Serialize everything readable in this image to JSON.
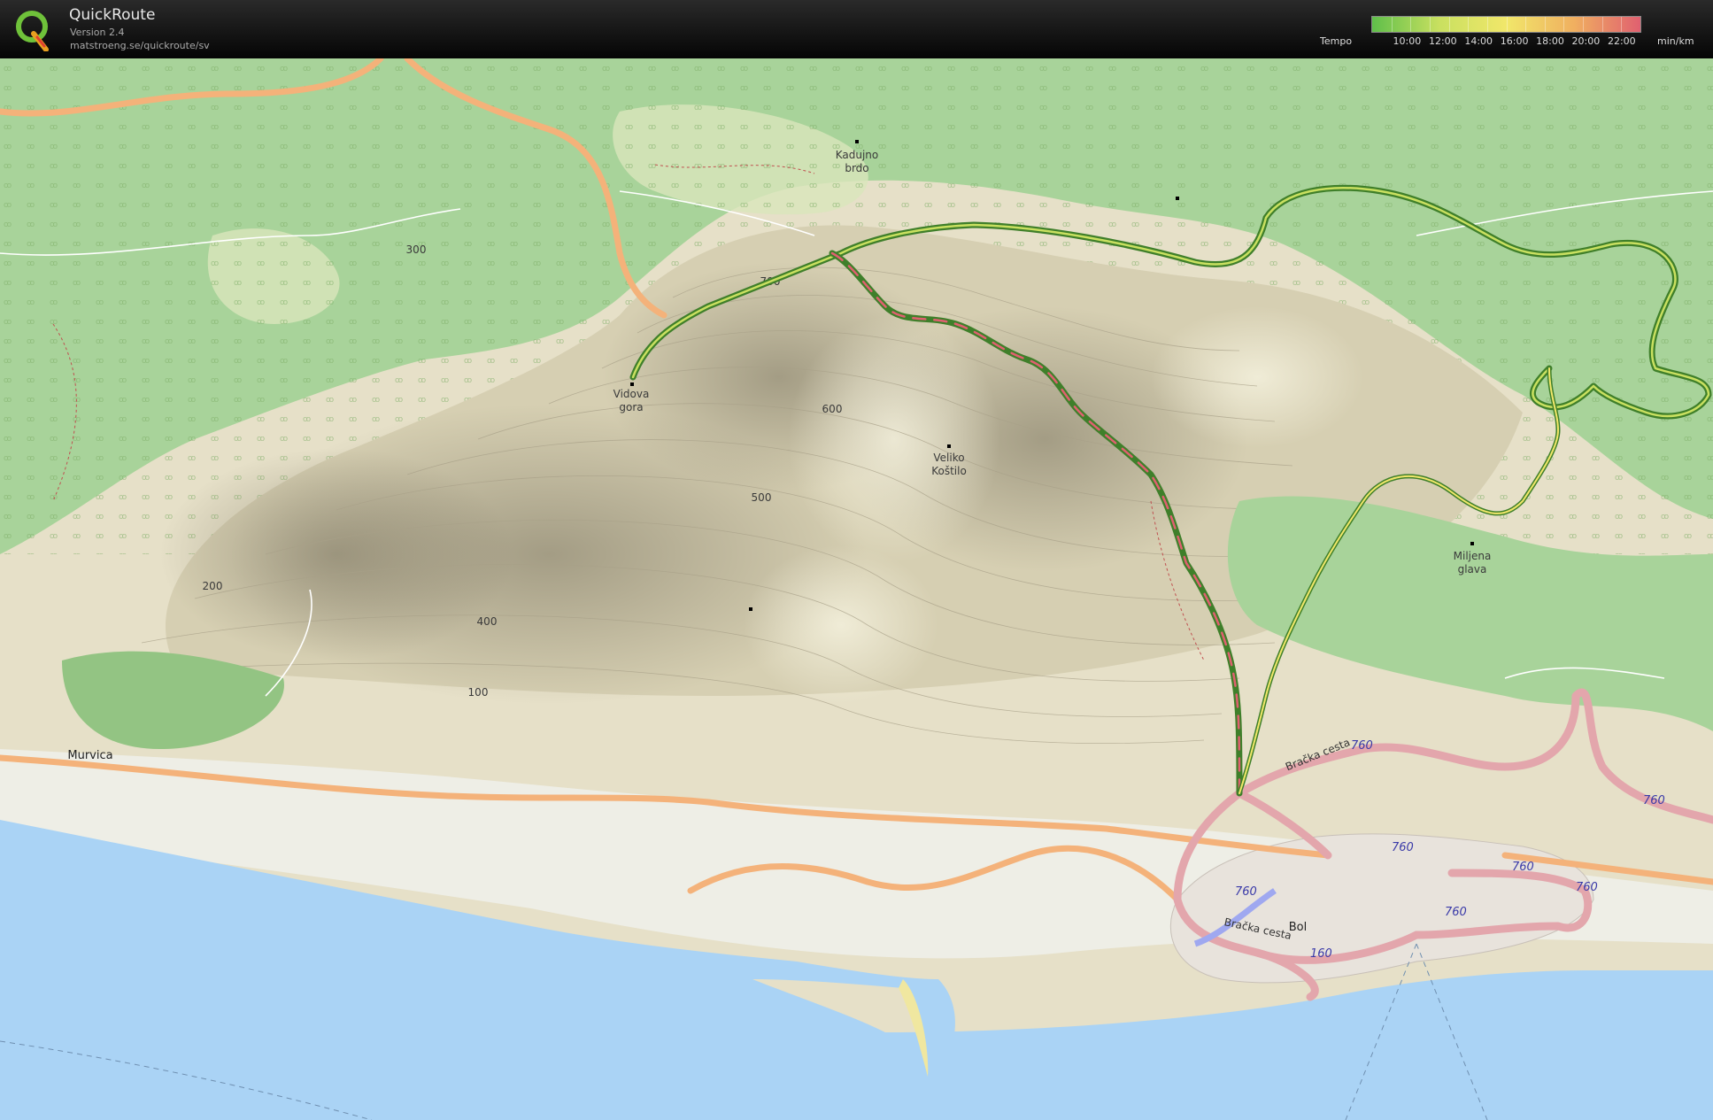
{
  "app": {
    "title": "QuickRoute",
    "version": "Version 2.4",
    "url": "matstroeng.se/quickroute/sv",
    "logo_letter": "Q"
  },
  "legend": {
    "label": "Tempo",
    "unit": "min/km",
    "ticks": [
      {
        "value": 10,
        "text": "10:00"
      },
      {
        "value": 12,
        "text": "12:00"
      },
      {
        "value": 14,
        "text": "14:00"
      },
      {
        "value": 16,
        "text": "16:00"
      },
      {
        "value": 18,
        "text": "18:00"
      },
      {
        "value": 20,
        "text": "20:00"
      },
      {
        "value": 22,
        "text": "22:00"
      }
    ],
    "range": [
      8,
      23
    ],
    "colors": [
      "#5fbf4a",
      "#c9e060",
      "#f1e76a",
      "#f0b060",
      "#e06070"
    ]
  },
  "map": {
    "places": [
      {
        "id": "kadujno-brdo",
        "lines": [
          "Kadujno",
          "brdo"
        ]
      },
      {
        "id": "vidova-gora",
        "lines": [
          "Vidova",
          "gora"
        ]
      },
      {
        "id": "veliko-kostilo",
        "lines": [
          "Veliko",
          "Koštilo"
        ]
      },
      {
        "id": "miljena-glava",
        "lines": [
          "Miljena",
          "glava"
        ]
      },
      {
        "id": "murvica",
        "lines": [
          "Murvica"
        ]
      },
      {
        "id": "bol",
        "lines": [
          "Bol"
        ]
      }
    ],
    "road_names": [
      "Bračka cesta",
      "Bračka cesta"
    ],
    "road_refs": [
      "760",
      "760",
      "760",
      "760",
      "760",
      "760",
      "760",
      "160"
    ],
    "contour_labels": [
      "700",
      "600",
      "500",
      "400",
      "300",
      "200",
      "100"
    ],
    "colors": {
      "sea": "#aad3f5",
      "forest": "#a8d39a",
      "scrub": "#cbe2b2",
      "land": "#e6e0c8",
      "highway": "#f4b27a",
      "route": "#3f7f2a",
      "urban": "#e3a6ac"
    }
  }
}
